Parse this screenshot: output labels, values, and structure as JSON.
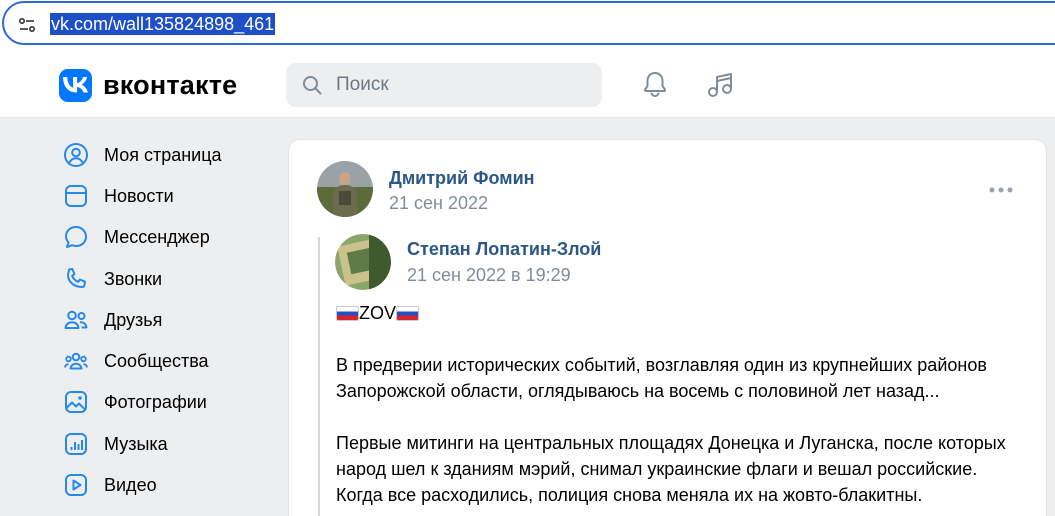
{
  "browser": {
    "url": "vk.com/wall135824898_461"
  },
  "header": {
    "brand": "вконтакте",
    "search_placeholder": "Поиск"
  },
  "sidebar": {
    "items": [
      {
        "label": "Моя страница",
        "icon": "user-circle-icon"
      },
      {
        "label": "Новости",
        "icon": "news-icon"
      },
      {
        "label": "Мессенджер",
        "icon": "message-icon"
      },
      {
        "label": "Звонки",
        "icon": "phone-icon"
      },
      {
        "label": "Друзья",
        "icon": "friends-icon"
      },
      {
        "label": "Сообщества",
        "icon": "communities-icon"
      },
      {
        "label": "Фотографии",
        "icon": "photo-icon"
      },
      {
        "label": "Музыка",
        "icon": "music-bars-icon"
      },
      {
        "label": "Видео",
        "icon": "video-icon"
      }
    ]
  },
  "post": {
    "author": "Дмитрий Фомин",
    "date": "21 сен 2022",
    "repost": {
      "author": "Степан Лопатин-Злой",
      "date": "21 сен 2022 в 19:29",
      "zov": "ZOV",
      "paragraph1_line1": "В предверии исторических событий, возглавляя один из крупнейших районов",
      "paragraph1_line2": "Запорожской области, оглядываюсь на восемь с половиной лет назад...",
      "paragraph2_line1": "Первые митинги на центральных площадях Донецка и Луганска, после которых",
      "paragraph2_line2": "народ шел к зданиям мэрий, снимал украинские флаги и вешал российские.",
      "paragraph2_line3": "Когда все расходились, полиция снова меняла их на жовто-блакитны."
    }
  },
  "colors": {
    "accent": "#0077ff",
    "link": "#2a5885",
    "secondary_text": "#818c99",
    "background": "#edeef0"
  }
}
